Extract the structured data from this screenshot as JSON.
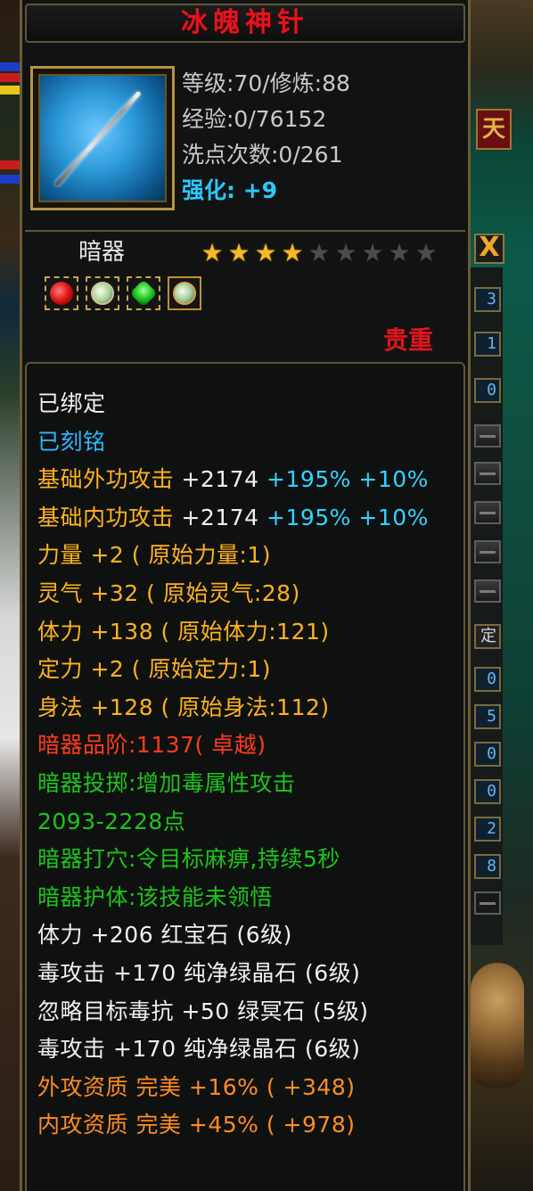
{
  "item": {
    "name": "冰魄神针",
    "level_line": "等级:70/修炼:88",
    "exp_line": "经验:0/76152",
    "reset_line": "洗点次数:0/261",
    "enhance_label": "强化:",
    "enhance_value": "+9",
    "type": "暗器",
    "stars_filled": 4,
    "stars_total": 9,
    "precious_label": "贵重",
    "sockets": [
      "red-gem",
      "pale-green-gem",
      "green-crystal",
      "pale-green-gem"
    ]
  },
  "stats": {
    "bound": "已绑定",
    "engraved": "已刻铭",
    "ext_attack": {
      "label": "基础外功攻击",
      "value": "+2174",
      "pct1": "+195%",
      "pct2": "+10%"
    },
    "int_attack": {
      "label": "基础内功攻击",
      "value": "+2174",
      "pct1": "+195%",
      "pct2": "+10%"
    },
    "strength": "力量 +2 ( 原始力量:1)",
    "spirit": "灵气 +32 ( 原始灵气:28)",
    "stamina": "体力 +138 ( 原始体力:121)",
    "focus": "定力 +2 ( 原始定力:1)",
    "agility": "身法 +128 ( 原始身法:112)",
    "grade": "暗器品阶:1137( 卓越)",
    "throw": "暗器投掷:增加毒属性攻击",
    "throw_range": "2093-2228点",
    "acupoint": "暗器打穴:令目标麻痹,持续5秒",
    "protect": "暗器护体:该技能未领悟",
    "gem1": "体力 +206 红宝石 (6级)",
    "gem2": "毒攻击 +170 纯净绿晶石 (6级)",
    "gem3": "忽略目标毒抗 +50 绿冥石 (5级)",
    "gem4": "毒攻击 +170 纯净绿晶石 (6级)",
    "ext_quality": "外攻资质 完美 +16% ( +348)",
    "int_quality": "内攻资质 完美 +45% ( +978)"
  },
  "side_panel": {
    "close_label": "X",
    "badge": "天",
    "values": [
      "3",
      "1",
      "0"
    ],
    "mode_label": "定",
    "readouts": [
      "0",
      "5",
      "0",
      "0",
      "2",
      "8"
    ]
  }
}
